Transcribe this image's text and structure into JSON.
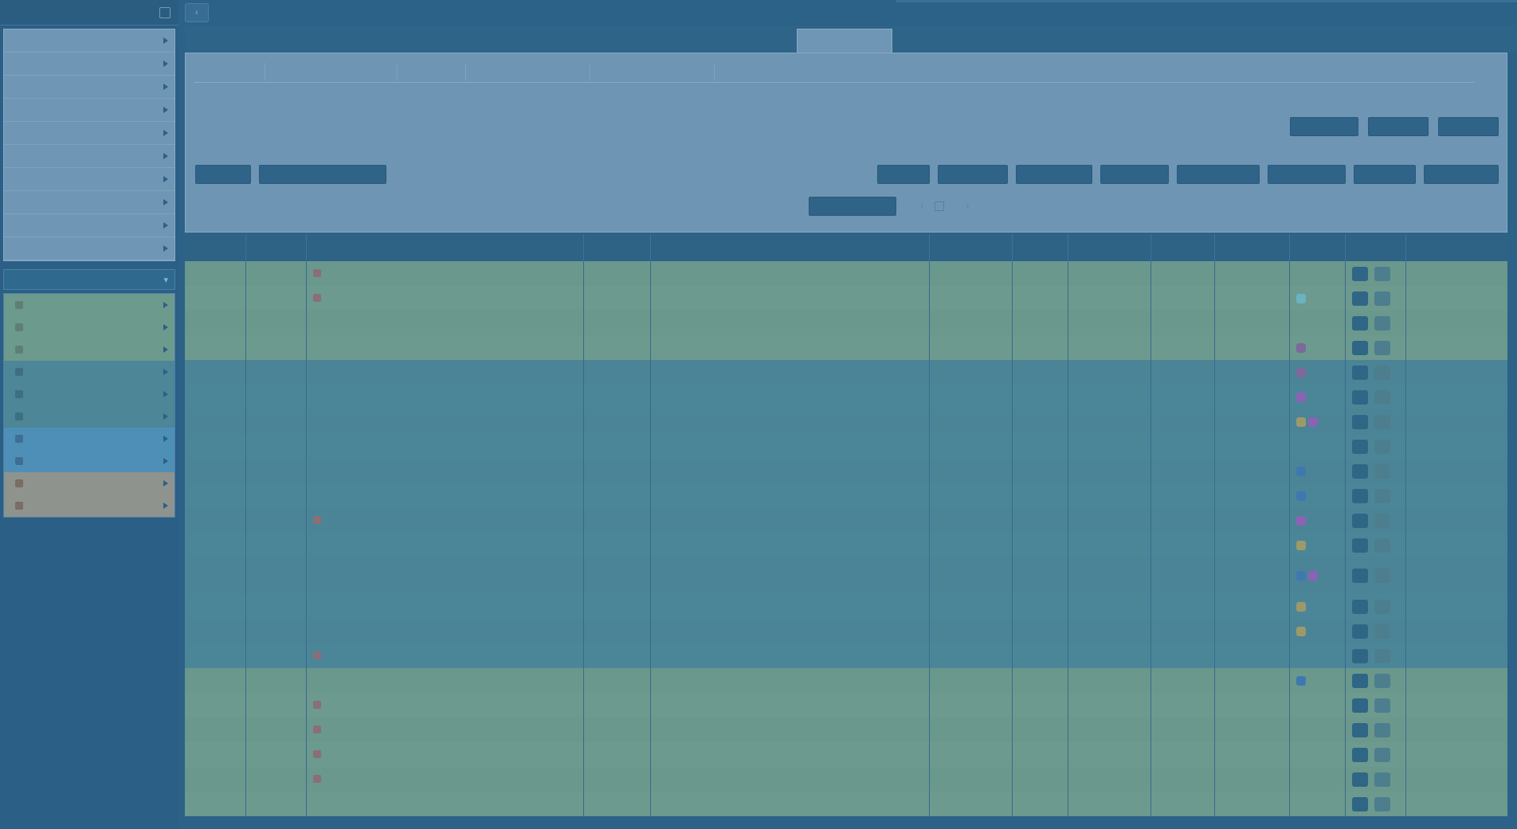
{
  "sidebar": {
    "header": "",
    "menu": [
      "",
      "",
      "",
      "",
      "",
      "",
      "",
      "",
      "",
      ""
    ],
    "section_title": "",
    "filters": [
      {
        "label": "",
        "group": "green"
      },
      {
        "label": "",
        "group": "green"
      },
      {
        "label": "",
        "group": "green"
      },
      {
        "label": "",
        "group": "teal"
      },
      {
        "label": "",
        "group": "teal"
      },
      {
        "label": "",
        "group": "teal"
      },
      {
        "label": "",
        "group": "blue"
      },
      {
        "label": "",
        "group": "blue"
      },
      {
        "label": "",
        "group": "tan"
      },
      {
        "label": "",
        "group": "tan"
      }
    ],
    "footer_left": "",
    "footer_right": ""
  },
  "topbar": {
    "back_icon": "chevron-left-icon",
    "title": ""
  },
  "main_tab": "",
  "subtabs": [
    "",
    "",
    "",
    "",
    ""
  ],
  "top_actions": [
    "",
    "",
    ""
  ],
  "left_actions": [
    "",
    ""
  ],
  "right_actions": [
    "",
    "",
    "",
    "",
    "",
    "",
    "",
    ""
  ],
  "pager": {
    "count_text": "",
    "go_label": "",
    "status": ""
  },
  "table": {
    "headers": [
      "",
      "",
      "",
      "",
      "",
      "",
      "",
      "",
      "",
      "",
      "",
      "",
      "",
      ""
    ],
    "rows": [
      {
        "style": "g",
        "c1": "",
        "c2": "",
        "icon": true,
        "c3": "",
        "c4": "",
        "c5": "",
        "c6": "",
        "c7": "",
        "c8": "",
        "c9": "",
        "c10": "",
        "tags": [],
        "c12": ""
      },
      {
        "style": "g",
        "c1": "",
        "c2": "",
        "icon": true,
        "c3": "",
        "c4": "",
        "c5": "",
        "c6": "",
        "c7": "",
        "c8": "",
        "c9": "",
        "c10": "",
        "tags": [
          "cyan"
        ],
        "c12": ""
      },
      {
        "style": "g",
        "c1": "",
        "c2": "",
        "icon": false,
        "c3": "",
        "c4": "",
        "c5": "",
        "c6": "",
        "c7": "",
        "c8": "",
        "c9": "",
        "c10": "",
        "tags": [],
        "c12": ""
      },
      {
        "style": "g",
        "c1": "",
        "c2": "",
        "icon": false,
        "c3": "",
        "c4": "",
        "c5": "",
        "c6": "",
        "c7": "",
        "c8": "",
        "c9": "",
        "c10": "",
        "tags": [
          "purple"
        ],
        "c12": ""
      },
      {
        "style": "t",
        "c1": "",
        "c2": "",
        "icon": false,
        "c3": "",
        "c4": "",
        "c5": "",
        "c6": "",
        "c7": "",
        "c8": "",
        "c9": "",
        "c10": "",
        "tags": [
          "purple"
        ],
        "c12": ""
      },
      {
        "style": "t",
        "c1": "",
        "c2": "",
        "icon": false,
        "c3": "",
        "c4": "",
        "c5": "",
        "c6": "",
        "c7": "",
        "c8": "",
        "c9": "",
        "c10": "",
        "tags": [
          "violet"
        ],
        "c12": ""
      },
      {
        "style": "t",
        "c1": "",
        "c2": "",
        "icon": false,
        "c3": "",
        "c4": "",
        "c5": "",
        "c6": "",
        "c7": "",
        "c8": "",
        "c9": "",
        "c10": "",
        "tags": [
          "olive",
          "violet"
        ],
        "c12": ""
      },
      {
        "style": "t",
        "c1": "",
        "c2": "",
        "icon": false,
        "c3": "",
        "c4": "",
        "c5": "",
        "c6": "",
        "c7": "",
        "c8": "",
        "c9": "",
        "c10": "",
        "tags": [],
        "c12": ""
      },
      {
        "style": "t",
        "c1": "",
        "c2": "",
        "icon": false,
        "c3": "",
        "c4": "",
        "c5": "",
        "c6": "",
        "c7": "",
        "c8": "",
        "c9": "",
        "c10": "",
        "tags": [
          "blue"
        ],
        "c12": ""
      },
      {
        "style": "t",
        "c1": "",
        "c2": "",
        "icon": false,
        "c3": "",
        "c4": "",
        "c5": "",
        "c6": "",
        "c7": "",
        "c8": "",
        "c9": "",
        "c10": "",
        "tags": [
          "blue"
        ],
        "c12": ""
      },
      {
        "style": "t",
        "c1": "",
        "c2": "",
        "icon": true,
        "c3": "",
        "c4": "",
        "c5": "",
        "c6": "",
        "c7": "",
        "c8": "",
        "c9": "",
        "c10": "",
        "tags": [
          "violet"
        ],
        "c12": ""
      },
      {
        "style": "t",
        "c1": "",
        "c2": "",
        "icon": false,
        "c3": "",
        "c4": "",
        "c5": "",
        "c6": "",
        "c7": "",
        "c8": "",
        "c9": "",
        "c10": "",
        "tags": [
          "olive"
        ],
        "c12": ""
      },
      {
        "style": "t tall",
        "c1": "",
        "c2": "",
        "icon": false,
        "c3": "",
        "c4": "",
        "c5": "",
        "c6": "",
        "c7": "",
        "c8": "",
        "c9": "",
        "c10": "",
        "tags": [
          "blue",
          "violet"
        ],
        "c12": ""
      },
      {
        "style": "t",
        "c1": "",
        "c2": "",
        "icon": false,
        "c3": "",
        "c4": "",
        "c5": "",
        "c6": "",
        "c7": "",
        "c8": "",
        "c9": "",
        "c10": "",
        "tags": [
          "olive"
        ],
        "c12": ""
      },
      {
        "style": "t",
        "c1": "",
        "c2": "",
        "icon": false,
        "c3": "",
        "c4": "",
        "c5": "",
        "c6": "",
        "c7": "",
        "c8": "",
        "c9": "",
        "c10": "",
        "tags": [
          "olive"
        ],
        "c12": ""
      },
      {
        "style": "t",
        "c1": "",
        "c2": "",
        "icon": true,
        "c3": "",
        "c4": "",
        "c5": "",
        "c6": "",
        "c7": "",
        "c8": "",
        "c9": "",
        "c10": "",
        "tags": [],
        "c12": ""
      },
      {
        "style": "g",
        "c1": "",
        "c2": "",
        "icon": false,
        "c3": "",
        "c4": "",
        "c5": "",
        "c6": "",
        "c7": "",
        "c8": "",
        "c9": "",
        "c10": "",
        "tags": [
          "blue"
        ],
        "c12": ""
      },
      {
        "style": "g",
        "c1": "",
        "c2": "",
        "icon": true,
        "c3": "",
        "c4": "",
        "c5": "",
        "c6": "",
        "c7": "",
        "c8": "",
        "c9": "",
        "c10": "",
        "tags": [],
        "c12": ""
      },
      {
        "style": "g",
        "c1": "",
        "c2": "",
        "icon": true,
        "c3": "",
        "c4": "",
        "c5": "",
        "c6": "",
        "c7": "",
        "c8": "",
        "c9": "",
        "c10": "",
        "tags": [],
        "c12": ""
      },
      {
        "style": "g",
        "c1": "",
        "c2": "",
        "icon": true,
        "c3": "",
        "c4": "",
        "c5": "",
        "c6": "",
        "c7": "",
        "c8": "",
        "c9": "",
        "c10": "",
        "tags": [],
        "c12": ""
      },
      {
        "style": "g",
        "c1": "",
        "c2": "",
        "icon": true,
        "c3": "",
        "c4": "",
        "c5": "",
        "c6": "",
        "c7": "",
        "c8": "",
        "c9": "",
        "c10": "",
        "tags": [],
        "c12": ""
      },
      {
        "style": "g",
        "c1": "",
        "c2": "",
        "icon": false,
        "c3": "",
        "c4": "",
        "c5": "",
        "c6": "",
        "c7": "",
        "c8": "",
        "c9": "",
        "c10": "",
        "tags": [],
        "c12": ""
      }
    ]
  },
  "colors": {
    "page_bg": "#2c6287",
    "panel_bg": "#6e95b3",
    "row_green": "#6c9a8f",
    "row_teal": "#4b8698",
    "row_blue": "#4e8fb8",
    "row_tan": "#8e938d",
    "button_bg": "#2f6388"
  }
}
